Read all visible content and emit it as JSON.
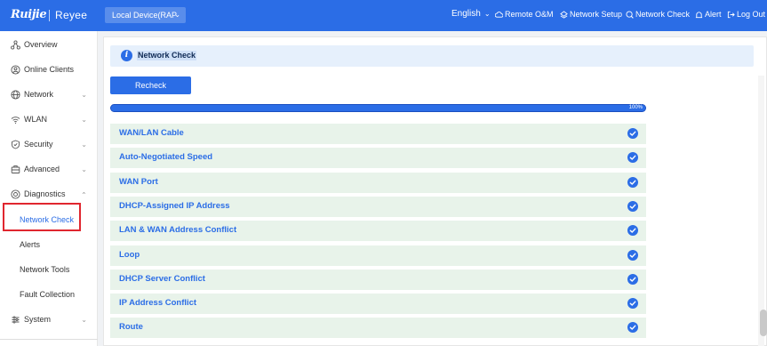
{
  "header": {
    "logo": "Ruijie",
    "logo_secondary": "Reyee",
    "device_select": "Local Device(RAP",
    "language": "English",
    "remote": "Remote O&M",
    "network_setup": "Network Setup",
    "network_check": "Network Check",
    "alert": "Alert",
    "logout": "Log Out"
  },
  "sidebar": {
    "items": [
      {
        "label": "Overview",
        "icon": "overview-icon"
      },
      {
        "label": "Online Clients",
        "icon": "clients-icon"
      },
      {
        "label": "Network",
        "icon": "globe-icon"
      },
      {
        "label": "WLAN",
        "icon": "wifi-icon"
      },
      {
        "label": "Security",
        "icon": "shield-icon"
      },
      {
        "label": "Advanced",
        "icon": "advanced-icon"
      },
      {
        "label": "Diagnostics",
        "icon": "diagnostics-icon"
      }
    ],
    "diagnostics_sub": [
      {
        "label": "Network Check"
      },
      {
        "label": "Alerts"
      },
      {
        "label": "Network Tools"
      },
      {
        "label": "Fault Collection"
      }
    ],
    "system": {
      "label": "System",
      "icon": "gear-icon"
    }
  },
  "main": {
    "info_title": "Network Check",
    "recheck_label": "Recheck",
    "progress_text": "100%",
    "progress_value": 100,
    "checks": [
      {
        "label": "WAN/LAN Cable"
      },
      {
        "label": "Auto-Negotiated Speed"
      },
      {
        "label": "WAN Port"
      },
      {
        "label": "DHCP-Assigned IP Address"
      },
      {
        "label": "LAN & WAN Address Conflict"
      },
      {
        "label": "Loop"
      },
      {
        "label": "DHCP Server Conflict"
      },
      {
        "label": "IP Address Conflict"
      },
      {
        "label": "Route"
      }
    ]
  },
  "colors": {
    "accent": "#2b6de6",
    "row_bg": "#e8f3ea",
    "highlight": "#e0262f"
  }
}
